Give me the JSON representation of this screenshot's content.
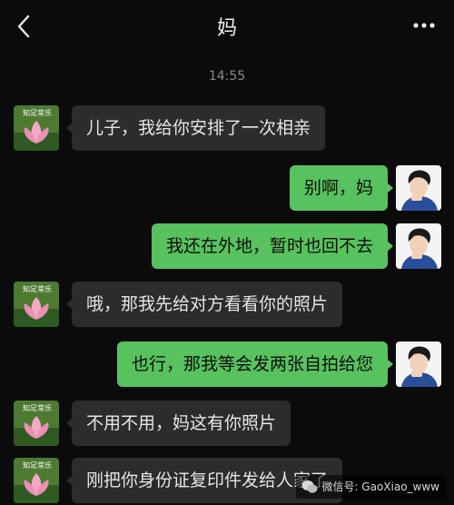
{
  "header": {
    "title": "妈",
    "back_icon": "chevron-left-icon",
    "more_icon": "more-dots-icon"
  },
  "timestamp": "14:55",
  "avatars": {
    "mom": {
      "caption": "知足常乐",
      "icon": "lotus-icon"
    },
    "son": {
      "icon": "cartoon-boy-icon"
    }
  },
  "messages": [
    {
      "sender": "mom",
      "text": "儿子，我给你安排了一次相亲"
    },
    {
      "sender": "son",
      "text": "别啊，妈"
    },
    {
      "sender": "son",
      "text": "我还在外地，暂时也回不去"
    },
    {
      "sender": "mom",
      "text": "哦，那我先给对方看看你的照片"
    },
    {
      "sender": "son",
      "text": "也行，那我等会发两张自拍给您"
    },
    {
      "sender": "mom",
      "text": "不用不用，妈这有你照片"
    },
    {
      "sender": "mom",
      "text": "刚把你身份证复印件发给人家了"
    }
  ],
  "watermark": {
    "text": "微信号: GaoXiao_www",
    "icon": "wechat-icon"
  },
  "colors": {
    "background": "#0b0b0b",
    "incoming_bubble": "#2c2c2c",
    "outgoing_bubble": "#58c25e"
  }
}
